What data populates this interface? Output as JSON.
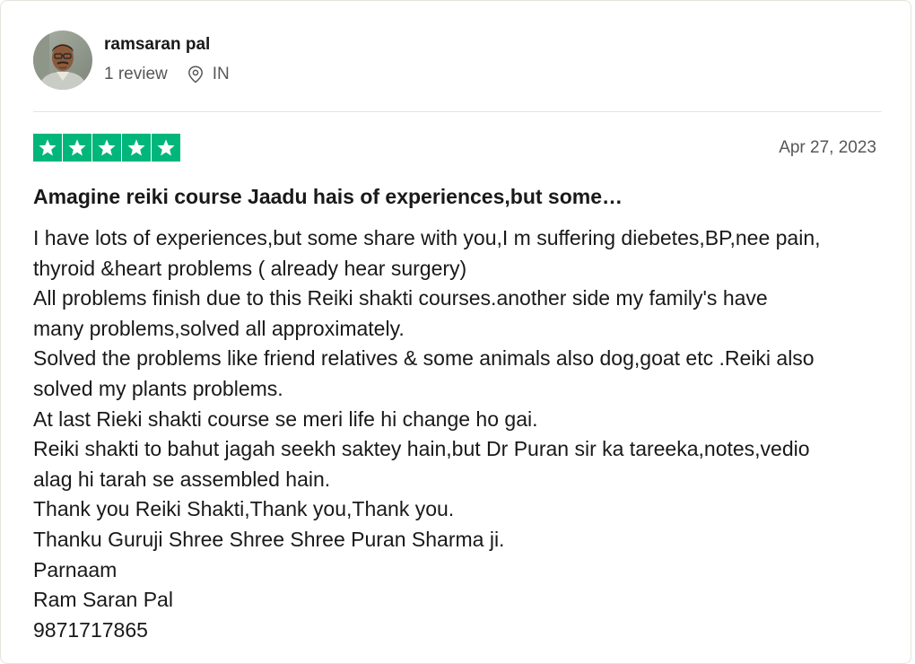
{
  "reviewer": {
    "name": "ramsaran pal",
    "review_count": "1 review",
    "country": "IN",
    "avatar_icon": "reviewer-photo"
  },
  "review": {
    "rating": 5,
    "max_rating": 5,
    "star_color": "#00b67a",
    "date": "Apr 27, 2023",
    "title": "Amagine reiki course Jaadu hais of experiences,but some…",
    "lines": [
      "I have lots of experiences,but some share with you,I m suffering diebetes,BP,nee pain,",
      "thyroid &heart problems ( already hear surgery)",
      "All problems finish due to this Reiki shakti courses.another side my family's have",
      "many problems,solved all approximately.",
      "Solved the problems like friend relatives & some animals also dog,goat etc .Reiki also",
      "solved my plants problems.",
      "At last Rieki shakti course se meri life hi change ho gai.",
      "Reiki shakti to bahut jagah seekh saktey hain,but Dr Puran sir ka tareeka,notes,vedio",
      "alag hi tarah se assembled hain.",
      "Thank you Reiki Shakti,Thank you,Thank you.",
      "Thanku Guruji Shree Shree Shree Puran Sharma ji.",
      "Parnaam",
      "Ram Saran Pal",
      "9871717865"
    ]
  }
}
